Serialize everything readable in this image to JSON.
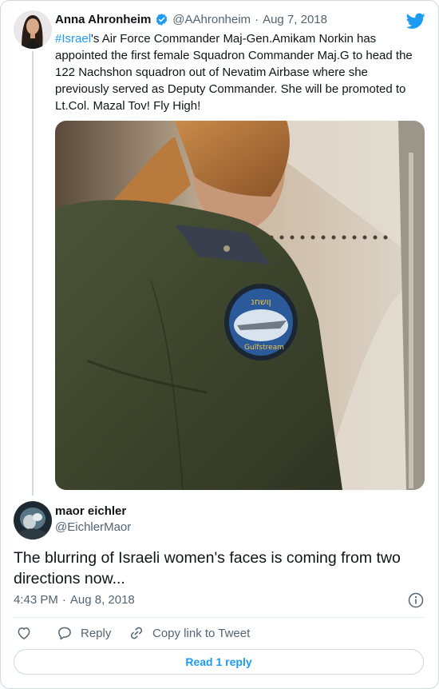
{
  "quoted_tweet": {
    "author_name": "Anna Ahronheim",
    "handle": "@AAhronheim",
    "separator": "·",
    "date": "Aug 7, 2018",
    "hashtag": "#Israel",
    "text": "'s Air Force Commander Maj-Gen.Amikam Norkin has appointed the first female Squadron Commander Maj.G to head the 122 Nachshon squadron out of Nevatim Airbase where she previously served as Deputy Commander. She will be promoted to Lt.Col. Mazal Tov! Fly High!",
    "photo": {
      "patch_top": "ןושחנ",
      "patch_bottom": "Gulfstream"
    }
  },
  "tweet": {
    "author_name": "maor eichler",
    "handle": "@EichlerMaor",
    "text": "The blurring of Israeli women's faces is coming from two directions now...",
    "time": "4:43 PM",
    "separator": "·",
    "date": "Aug 8, 2018"
  },
  "actions": {
    "reply_label": "Reply",
    "copy_link_label": "Copy link to Tweet"
  },
  "read_replies_label": "Read 1 reply",
  "icons": [
    "twitter-bird-icon",
    "verified-badge-icon",
    "info-icon",
    "heart-icon",
    "reply-icon",
    "link-icon"
  ],
  "colors": {
    "accent": "#1d9bf0",
    "text": "#0f1419",
    "muted": "#536471"
  }
}
